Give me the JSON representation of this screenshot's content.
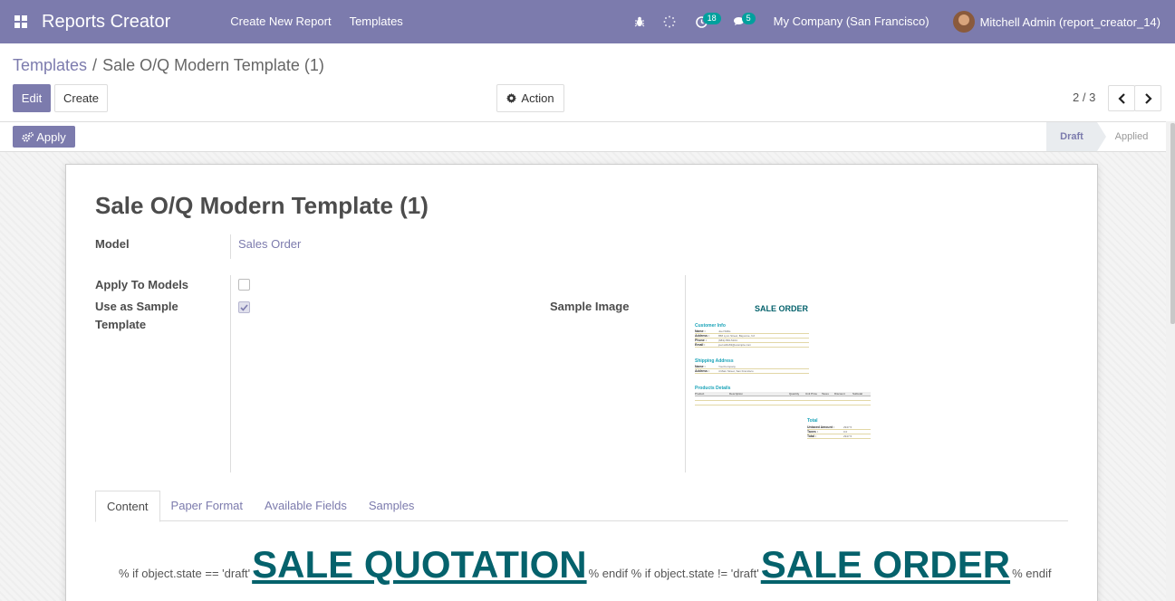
{
  "navbar": {
    "app_title": "Reports Creator",
    "menu": [
      "Create New Report",
      "Templates"
    ],
    "activity_count": "18",
    "message_count": "5",
    "company": "My Company (San Francisco)",
    "user": "Mitchell Admin (report_creator_14)"
  },
  "breadcrumb": {
    "parent": "Templates",
    "separator": "/",
    "current": "Sale O/Q Modern Template (1)"
  },
  "buttons": {
    "edit": "Edit",
    "create": "Create",
    "action": "Action",
    "apply": "Apply"
  },
  "pager": {
    "value": "2 / 3"
  },
  "statusbar": {
    "states": [
      "Draft",
      "Applied"
    ],
    "active": "Draft"
  },
  "form": {
    "title": "Sale O/Q Modern Template (1)",
    "model_label": "Model",
    "model_value": "Sales Order",
    "apply_to_models_label": "Apply To Models",
    "apply_to_models_checked": false,
    "sample_template_label": "Use as Sample Template",
    "sample_template_checked": true,
    "sample_image_label": "Sample Image"
  },
  "sample_image": {
    "title": "SALE ORDER",
    "customer_section": "Customer Info",
    "customer_rows": [
      {
        "k": "Name :",
        "v": "Joel Willis"
      },
      {
        "k": "Address :",
        "v": "858 Lynn Street, Bayonne, NJ"
      },
      {
        "k": "Phone :",
        "v": "(683)-556-5104"
      },
      {
        "k": "Email :",
        "v": "joel.willis63@example.com"
      }
    ],
    "shipping_section": "Shipping Address",
    "shipping_rows": [
      {
        "k": "Name :",
        "v": "YourCompany"
      },
      {
        "k": "Address :",
        "v": "4 Main Street, San Francisco"
      }
    ],
    "products_section": "Products Details",
    "products_columns": [
      "Product",
      "Description",
      "Quantity",
      "Unit Price",
      "Taxes",
      "Discount",
      "Subtotal"
    ],
    "totals_section": "Total",
    "totals_rows": [
      {
        "k": "Untaxed Amount :",
        "v": "2947.5"
      },
      {
        "k": "Taxes :",
        "v": "0.0"
      },
      {
        "k": "Total :",
        "v": "2947.5"
      }
    ]
  },
  "tabs": [
    "Content",
    "Paper Format",
    "Available Fields",
    "Samples"
  ],
  "active_tab": "Content",
  "content_preview": {
    "part1": "% if object.state == 'draft'",
    "heading1": "SALE QUOTATION",
    "part2": "% endif % if object.state != 'draft'",
    "heading2": "SALE ORDER",
    "part3": "% endif"
  },
  "colors": {
    "brand": "#7c7bad",
    "heading_teal": "#05626c",
    "badge": "#00a09d"
  }
}
